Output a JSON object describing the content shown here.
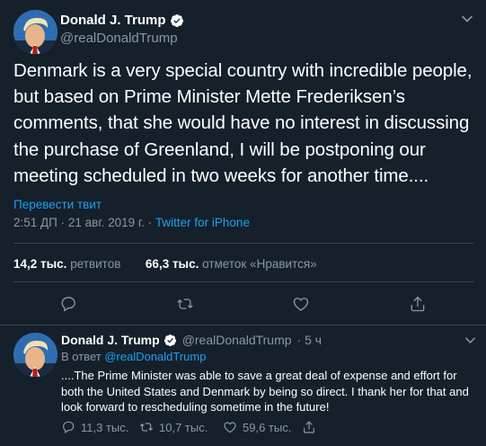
{
  "colors": {
    "background": "#15202b",
    "text": "#ffffff",
    "secondary": "#8899a6",
    "accent": "#1da1f2",
    "divider": "#38444d"
  },
  "main_tweet": {
    "display_name": "Donald J. Trump",
    "handle": "@realDonaldTrump",
    "verified": true,
    "text": "Denmark is a very special country with incredible people, but based on Prime Minister Mette Frederiksen’s comments, that she would have no interest in discussing the purchase of Greenland, I will be postponing our meeting scheduled in two weeks for another time....",
    "translate_label": "Перевести твит",
    "timestamp": "2:51 ДП · 21 авг. 2019 г.",
    "separator": " · ",
    "source": "Twitter for iPhone",
    "stats": {
      "retweets_count": "14,2 тыс.",
      "retweets_label": "ретвитов",
      "likes_count": "66,3 тыс.",
      "likes_label": "отметок «Нравится»"
    },
    "actions": [
      "reply-icon",
      "retweet-icon",
      "like-icon",
      "share-icon"
    ]
  },
  "reply_tweet": {
    "display_name": "Donald J. Trump",
    "handle": "@realDonaldTrump",
    "time_ago": "· 5 ч",
    "verified": true,
    "in_reply_prefix": "В ответ",
    "in_reply_mention": "@realDonaldTrump",
    "text": "....The Prime Minister was able to save a great deal of expense and effort for both the United States and Denmark by being so direct. I thank her for that and look forward to rescheduling sometime in the future!",
    "actions": {
      "replies": "11,3 тыс.",
      "retweets": "10,7 тыс.",
      "likes": "59,6 тыс."
    }
  }
}
